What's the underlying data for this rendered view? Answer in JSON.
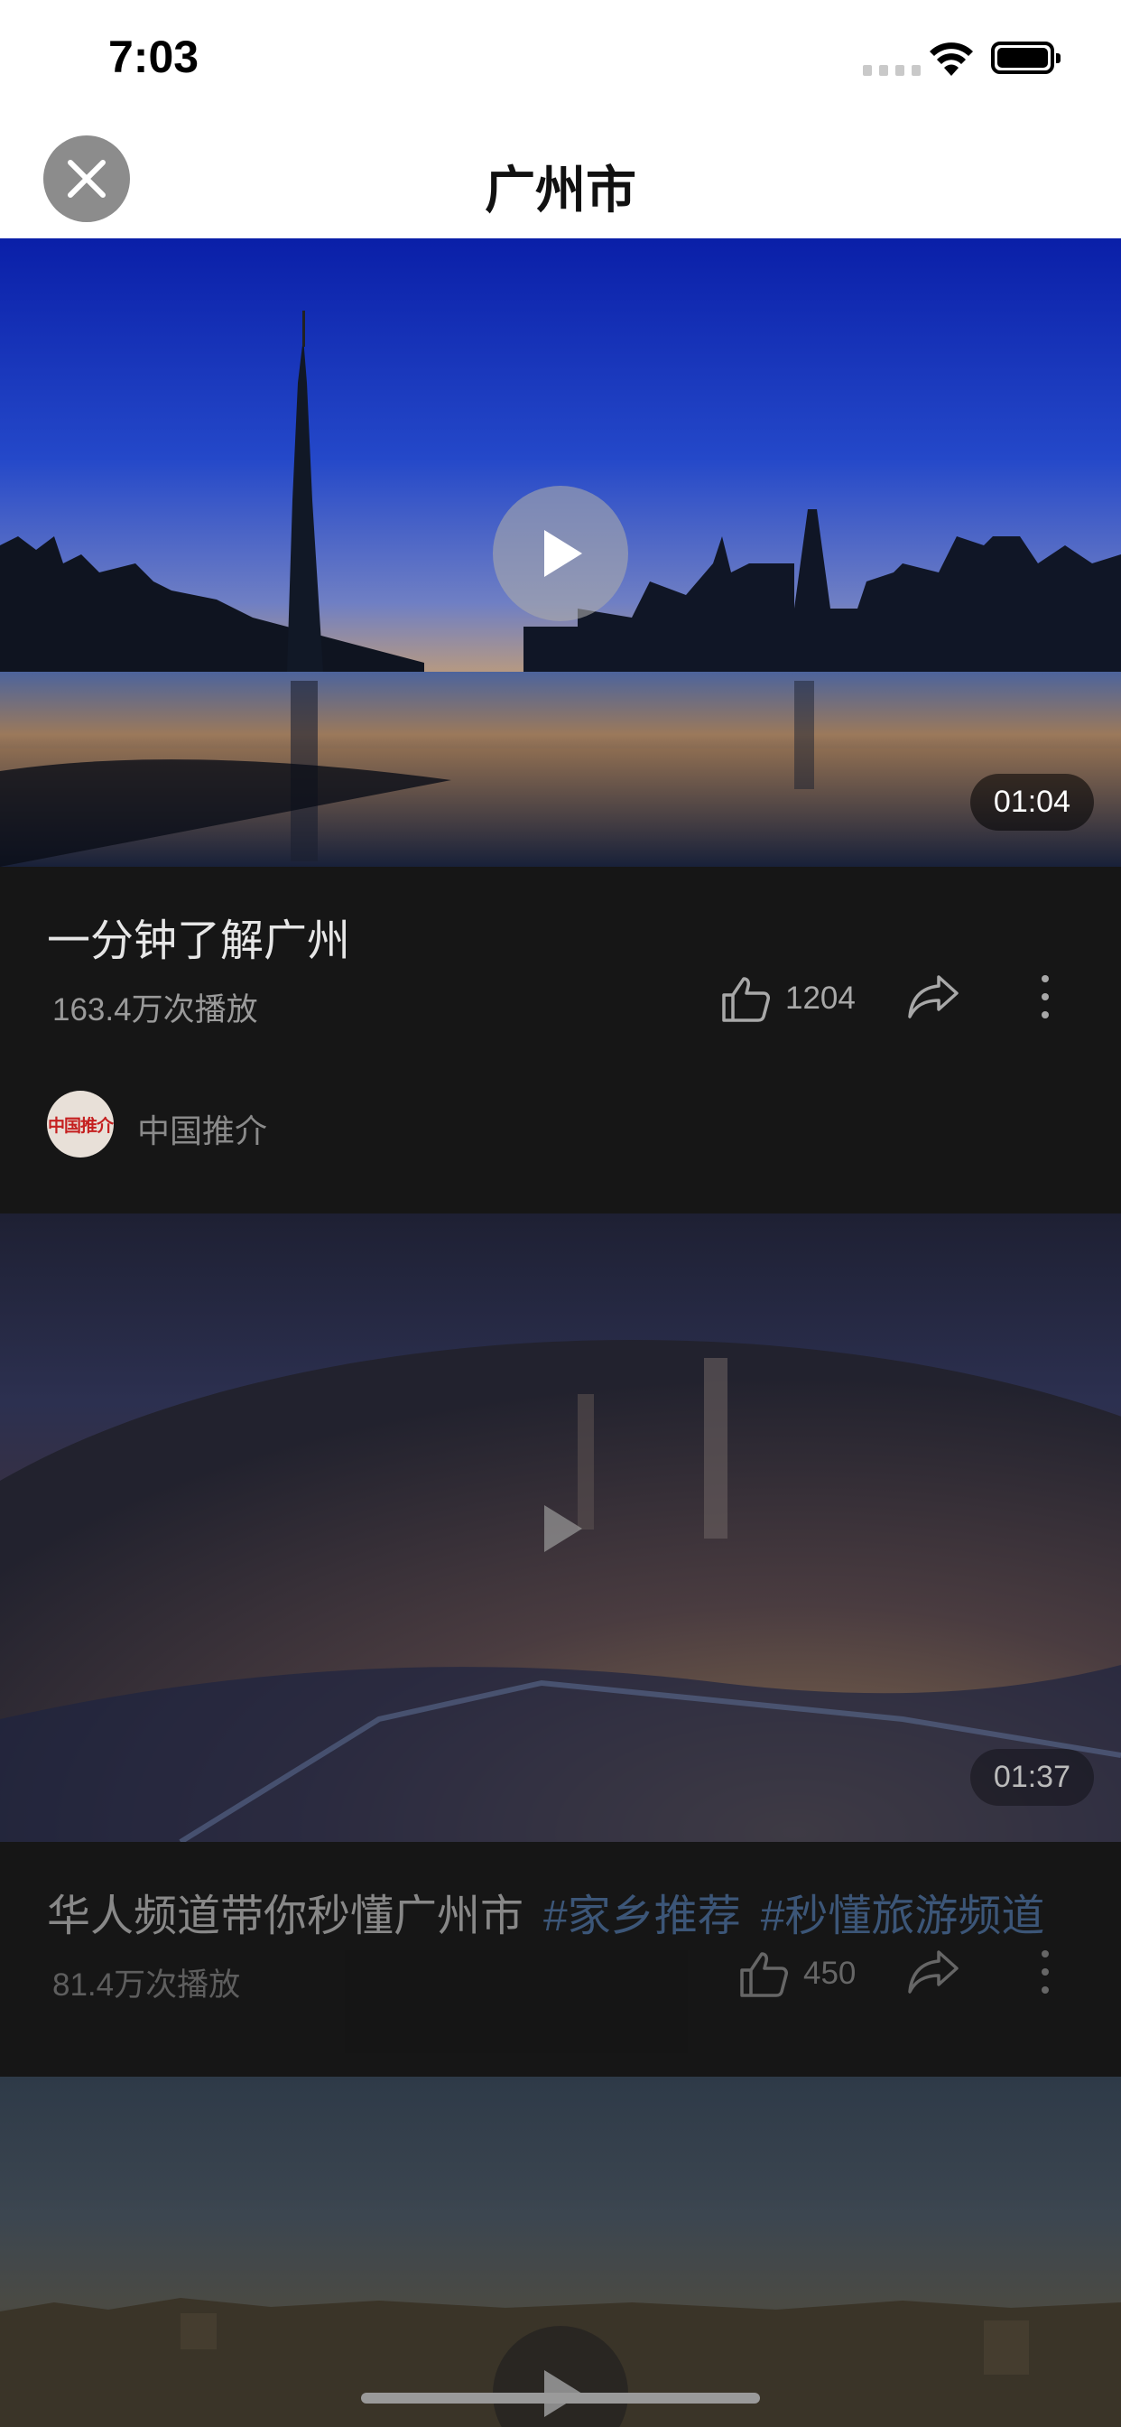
{
  "status_bar": {
    "time": "7:03"
  },
  "nav": {
    "title": "广州市",
    "close_icon": "close-icon"
  },
  "videos": [
    {
      "title": "一分钟了解广州",
      "tags": [],
      "duration": "01:04",
      "views": "163.4万次播放",
      "likes": "1204",
      "channel": "中国推介",
      "channel_logo_text": "中国推介"
    },
    {
      "title": "华人频道带你秒懂广州市",
      "tags": [
        "#家乡推荐",
        "#秒懂旅游频道"
      ],
      "duration": "01:37",
      "views": "81.4万次播放",
      "likes": "450"
    }
  ],
  "colors": {
    "background": "#161616",
    "tag": "#5b8cc9",
    "header": "#ffffff"
  }
}
